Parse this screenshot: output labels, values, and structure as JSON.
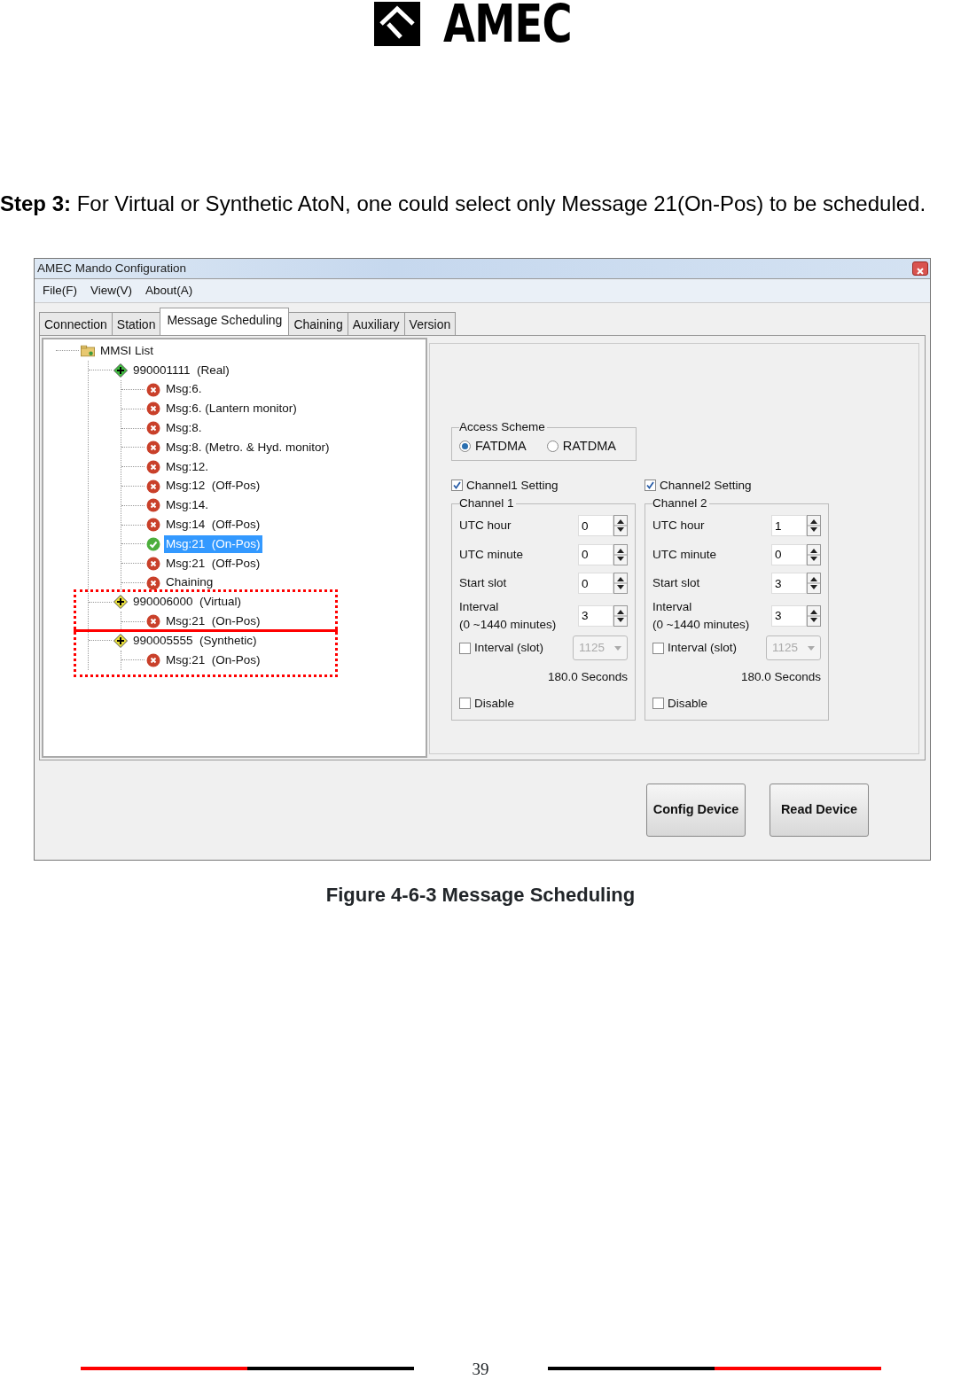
{
  "logo": {
    "text": "AMEC"
  },
  "step_text": "**Step 3:** For Virtual or Synthetic AtoN, one could select only Message 21(On-Pos) to be scheduled.",
  "window": {
    "title": "AMEC Mando Configuration"
  },
  "menu": [
    "File(F)",
    "View(V)",
    "About(A)"
  ],
  "tabs": [
    {
      "label": "Connection",
      "selected": false
    },
    {
      "label": "Station",
      "selected": false
    },
    {
      "label": "Message Scheduling",
      "selected": true
    },
    {
      "label": "Chaining",
      "selected": false
    },
    {
      "label": "Auxiliary",
      "selected": false
    },
    {
      "label": "Version",
      "selected": false
    }
  ],
  "tree": {
    "label": "MMSI List",
    "children": [
      {
        "label": "990001111  (Real)",
        "kind": "real",
        "children": [
          {
            "label": "Msg:6.",
            "enabled": false,
            "selected": false
          },
          {
            "label": "Msg:6. (Lantern monitor)",
            "enabled": false,
            "selected": false
          },
          {
            "label": "Msg:8.",
            "enabled": false,
            "selected": false
          },
          {
            "label": "Msg:8. (Metro. & Hyd. monitor)",
            "enabled": false,
            "selected": false
          },
          {
            "label": "Msg:12.",
            "enabled": false,
            "selected": false
          },
          {
            "label": "Msg:12  (Off-Pos)",
            "enabled": false,
            "selected": false
          },
          {
            "label": "Msg:14.",
            "enabled": false,
            "selected": false
          },
          {
            "label": "Msg:14  (Off-Pos)",
            "enabled": false,
            "selected": false
          },
          {
            "label": "Msg:21  (On-Pos)",
            "enabled": true,
            "selected": true
          },
          {
            "label": "Msg:21  (Off-Pos)",
            "enabled": false,
            "selected": false
          },
          {
            "label": "Chaining",
            "enabled": false,
            "selected": false
          }
        ]
      },
      {
        "label": "990006000  (Virtual)",
        "kind": "virtual",
        "children": [
          {
            "label": "Msg:21  (On-Pos)",
            "enabled": false,
            "selected": false
          }
        ]
      },
      {
        "label": "990005555  (Synthetic)",
        "kind": "synthetic",
        "children": [
          {
            "label": "Msg:21  (On-Pos)",
            "enabled": false,
            "selected": false
          }
        ]
      }
    ]
  },
  "access_scheme": {
    "title": "Access Scheme",
    "options": [
      {
        "label": "FATDMA",
        "selected": true
      },
      {
        "label": "RATDMA",
        "selected": false
      }
    ]
  },
  "channels": [
    {
      "setting_label": "Channel1 Setting",
      "checked": true,
      "title": "Channel 1",
      "fields": [
        {
          "label": "UTC hour",
          "value": "0"
        },
        {
          "label": "UTC minute",
          "value": "0"
        },
        {
          "label": "Start slot",
          "value": "0"
        },
        {
          "label": "Interval",
          "sublabel": "(0 ~1440 minutes)",
          "value": "3"
        }
      ],
      "interval_slot": {
        "label": "Interval (slot)",
        "checked": false,
        "value": "1125",
        "disabled": true
      },
      "seconds": "180.0 Seconds",
      "disable": {
        "label": "Disable",
        "checked": false
      }
    },
    {
      "setting_label": "Channel2 Setting",
      "checked": true,
      "title": "Channel 2",
      "fields": [
        {
          "label": "UTC hour",
          "value": "1"
        },
        {
          "label": "UTC minute",
          "value": "0"
        },
        {
          "label": "Start slot",
          "value": "3"
        },
        {
          "label": "Interval",
          "sublabel": "(0 ~1440 minutes)",
          "value": "3"
        }
      ],
      "interval_slot": {
        "label": "Interval (slot)",
        "checked": false,
        "value": "1125",
        "disabled": true
      },
      "seconds": "180.0 Seconds",
      "disable": {
        "label": "Disable",
        "checked": false
      }
    }
  ],
  "buttons": [
    "Config Device",
    "Read Device"
  ],
  "caption": "Figure 4-6-3 Message Scheduling",
  "page_number": "39"
}
